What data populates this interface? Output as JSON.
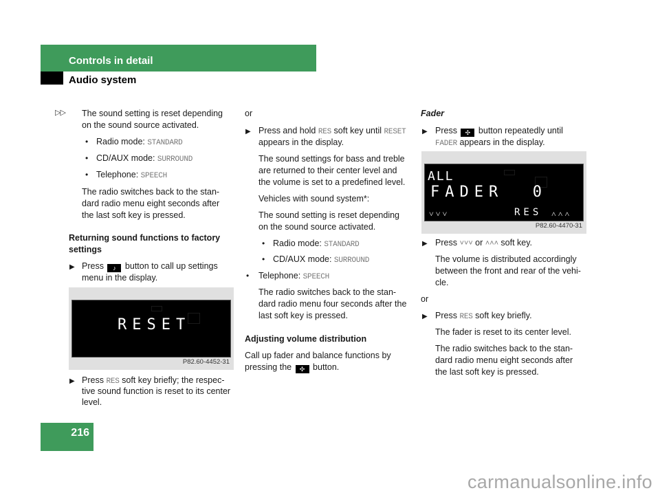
{
  "header": {
    "section": "Controls in detail",
    "subsection": "Audio system"
  },
  "page_number": "216",
  "watermark": "carmanualsonline.info",
  "continuation_marker": "▷▷",
  "icons": {
    "settings_button": "settings-button-icon",
    "fader_balance_button": "fader-balance-button-icon"
  },
  "col1": {
    "intro_l1": "The sound setting is reset depending",
    "intro_l2": "on the sound source activated.",
    "modes": [
      {
        "label": "Radio mode: ",
        "value": "STANDARD"
      },
      {
        "label": "CD/AUX mode: ",
        "value": "SURROUND"
      },
      {
        "label": "Telephone: ",
        "value": "SPEECH"
      }
    ],
    "switch_l1": "The radio switches back to the stan-",
    "switch_l2": "dard radio menu eight seconds after",
    "switch_l3": "the last soft key is pressed.",
    "heading_l1": "Returning sound functions to factory",
    "heading_l2": "settings",
    "step1_pre": "Press ",
    "step1_post": " button to call up settings",
    "step1_l2": "menu in the display.",
    "figure": {
      "display_text": "RESET",
      "code": "P82.60-4452-31"
    },
    "step2_pre": "Press ",
    "step2_key": "RES",
    "step2_post": " soft key briefly; the respec-",
    "step2_l2": "tive sound function is reset to its center",
    "step2_l3": "level."
  },
  "col2": {
    "or": "or",
    "step_pre": "Press and hold ",
    "step_key": "RES",
    "step_mid": " soft key until ",
    "step_key2": "RESET",
    "step_l2": "appears in the display.",
    "bass_l1": "The sound settings for bass and treble",
    "bass_l2": "are returned to their center level and",
    "bass_l3": "the volume is set to a predefined level.",
    "vehicles": "Vehicles with sound system*:",
    "reset_l1": "The sound setting is reset depending",
    "reset_l2": "on the sound source activated.",
    "modes": [
      {
        "label": "Radio mode: ",
        "value": "STANDARD"
      },
      {
        "label": "CD/AUX mode: ",
        "value": "SURROUND"
      },
      {
        "label": "Telephone: ",
        "value": "SPEECH"
      }
    ],
    "switch_l1": "The radio switches back to the stan-",
    "switch_l2": "dard radio menu four seconds after the",
    "switch_l3": "last soft key is pressed.",
    "heading": "Adjusting volume distribution",
    "call_l1": "Call up fader and balance functions by",
    "call_l2_pre": "pressing the ",
    "call_l2_post": " button."
  },
  "col3": {
    "heading": "Fader",
    "step1_pre": "Press ",
    "step1_post": " button repeatedly until",
    "step1_key": "FADER",
    "step1_l2": " appears in the display.",
    "figure": {
      "line1": "ALL",
      "line2": "FADER  0",
      "softkey_left": "˅˅˅",
      "softkey_mid": "RES",
      "softkey_right": "˄˄˄",
      "code": "P82.60-4470-31"
    },
    "step2_pre": "Press ",
    "step2_k1": "˅˅˅",
    "step2_mid": " or ",
    "step2_k2": "˄˄˄",
    "step2_post": " soft key.",
    "vol_l1": "The volume is distributed accordingly",
    "vol_l2": "between the front and rear of the vehi-",
    "vol_l3": "cle.",
    "or": "or",
    "step3_pre": "Press ",
    "step3_key": "RES",
    "step3_post": " soft key briefly.",
    "fader_reset": "The fader is reset to its center level.",
    "switch_l1": "The radio switches back to the stan-",
    "switch_l2": "dard radio menu eight seconds after",
    "switch_l3": "the last soft key is pressed."
  }
}
